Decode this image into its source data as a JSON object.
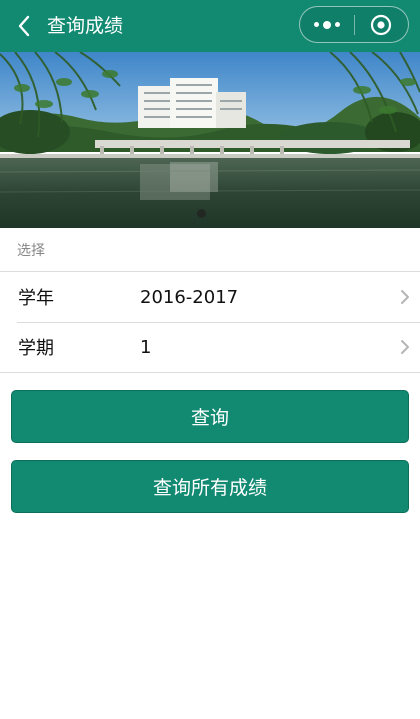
{
  "header": {
    "title": "查询成绩"
  },
  "icons": {
    "back": "chevron-left-icon",
    "more": "more-dots-icon",
    "close": "target-circle-icon",
    "arrow": "chevron-right-icon"
  },
  "colors": {
    "primary": "#128a72"
  },
  "section": {
    "label": "选择"
  },
  "picker": {
    "year": {
      "label": "学年",
      "value": "2016-2017"
    },
    "term": {
      "label": "学期",
      "value": "1"
    }
  },
  "buttons": {
    "query": "查询",
    "query_all": "查询所有成绩"
  }
}
